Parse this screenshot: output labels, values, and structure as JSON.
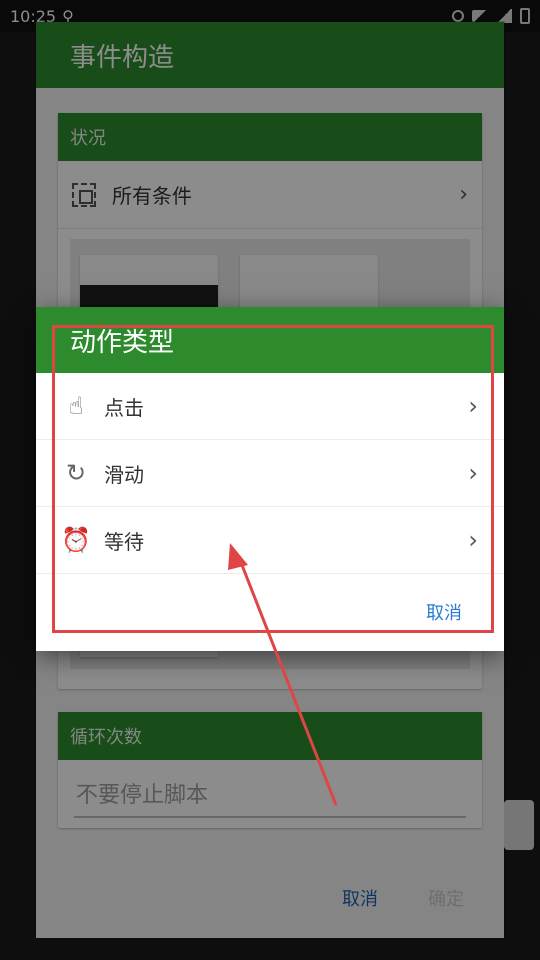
{
  "status_bar": {
    "time": "10:25"
  },
  "background_dialog": {
    "title": "事件构造",
    "conditions_section": {
      "header": "状况",
      "row_label": "所有条件"
    },
    "loop_section": {
      "header": "循环次数",
      "input_placeholder": "不要停止脚本"
    },
    "footer": {
      "cancel": "取消",
      "ok": "确定"
    }
  },
  "action_dialog": {
    "title": "动作类型",
    "items": [
      {
        "label": "点击",
        "icon": "tap-hand-icon"
      },
      {
        "label": "滑动",
        "icon": "swipe-hand-icon"
      },
      {
        "label": "等待",
        "icon": "alarm-clock-icon"
      }
    ],
    "cancel": "取消"
  },
  "colors": {
    "header_green": "#2d8a2d",
    "link_blue": "#2b7cd3",
    "annotation_red": "#e04545"
  }
}
